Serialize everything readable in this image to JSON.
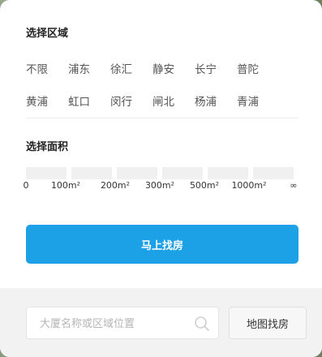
{
  "region": {
    "title": "选择区域",
    "rows": [
      [
        "不限",
        "浦东",
        "徐汇",
        "静安",
        "长宁",
        "普陀"
      ],
      [
        "黄浦",
        "虹口",
        "闵行",
        "闸北",
        "杨浦",
        "青浦"
      ]
    ]
  },
  "area": {
    "title": "选择面积",
    "segment_count": 6,
    "tick_labels": [
      "0",
      "100m²",
      "200m²",
      "300m²",
      "500m²",
      "1000m²",
      "∞"
    ]
  },
  "action": {
    "find_label": "马上找房"
  },
  "footer": {
    "search_placeholder": "大厦名称或区域位置",
    "map_label": "地图找房"
  },
  "colors": {
    "accent": "#1da1e6",
    "segment": "#f0f0f0",
    "footer_bg": "#f2f2f2"
  },
  "icons": {
    "search": "search-icon"
  }
}
